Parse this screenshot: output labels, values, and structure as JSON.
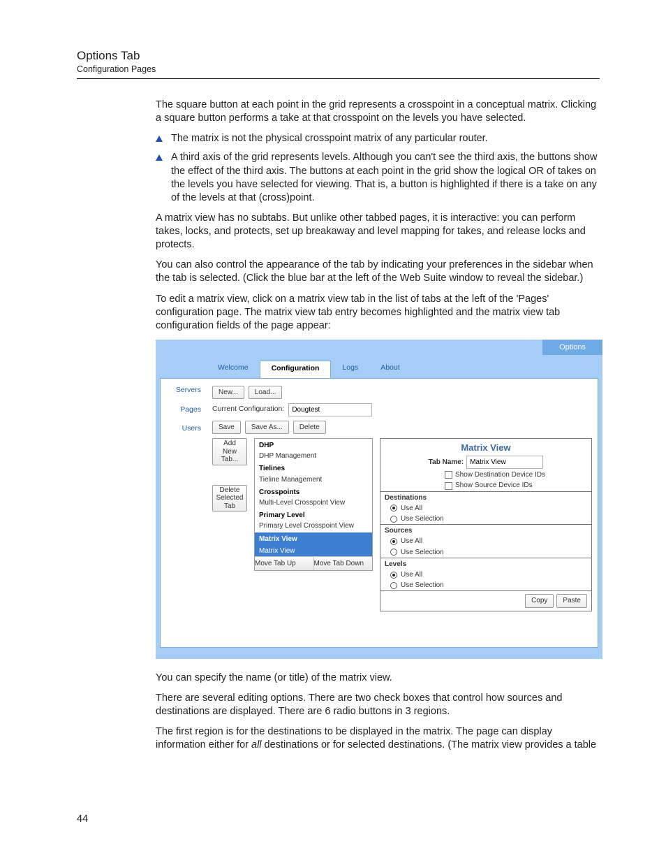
{
  "header": {
    "title": "Options Tab",
    "subtitle": "Configuration Pages"
  },
  "page_number": "44",
  "body": {
    "p1": "The square button at each point in the grid represents a crosspoint in a conceptual matrix. Clicking a square button performs a take at that crosspoint on the levels you have selected.",
    "b1": "The matrix is not the physical crosspoint matrix of any particular router.",
    "b2": "A third axis of the grid represents levels. Although you can't see the third axis, the buttons show the effect of the third axis. The buttons at each point in the grid show the logical OR of takes on the levels you have selected for viewing. That is, a button is highlighted if there is a take on any of the levels at that (cross)point.",
    "p2": "A matrix view has no subtabs. But unlike other tabbed pages, it is interactive: you can perform takes, locks, and protects, set up breakaway and level mapping for takes, and release locks and protects.",
    "p3": "You can also control the appearance of the tab by indicating your preferences in the sidebar when the tab is selected. (Click the blue bar at the left of the Web Suite window to reveal the sidebar.)",
    "p4": "To edit a matrix view, click on a matrix view tab in the list of tabs at the left of the 'Pages' configuration page. The matrix view tab entry becomes highlighted and the matrix view tab configuration fields of the page appear:",
    "p5": "You can specify the name (or title) of the matrix view.",
    "p6": "There are several editing options. There are two check boxes that control how sources and destinations are displayed. There are 6 radio buttons in 3 regions.",
    "p7a": "The first region is for the destinations to be displayed in the matrix. The page can display information either for ",
    "p7i": "all",
    "p7b": " destinations or for selected destinations. (The matrix view provides a table"
  },
  "app": {
    "top_tab": "Options",
    "nav": {
      "welcome": "Welcome",
      "configuration": "Configuration",
      "logs": "Logs",
      "about": "About"
    },
    "side": {
      "servers": "Servers",
      "pages": "Pages",
      "users": "Users"
    },
    "toolbar": {
      "new": "New...",
      "load": "Load...",
      "current_label": "Current Configuration:",
      "current_value": "Dougtest",
      "save": "Save",
      "save_as": "Save As...",
      "delete": "Delete"
    },
    "leftbtns": {
      "add": "Add\nNew\nTab...",
      "del": "Delete\nSelected\nTab"
    },
    "tree": {
      "g1": "DHP",
      "i1": "DHP Management",
      "g2": "Tielines",
      "i2": "Tieline Management",
      "g3": "Crosspoints",
      "i3": "Multi-Level Crosspoint View",
      "g4": "Primary Level",
      "i4": "Primary Level Crosspoint View",
      "g5": "Matrix View",
      "i5": "Matrix View",
      "up": "Move Tab Up",
      "down": "Move Tab Down"
    },
    "form": {
      "title": "Matrix View",
      "tabname_label": "Tab Name:",
      "tabname_value": "Matrix View",
      "chk_dest": "Show Destination Device IDs",
      "chk_src": "Show Source Device IDs",
      "sec_dest": "Destinations",
      "sec_src": "Sources",
      "sec_lvl": "Levels",
      "use_all": "Use All",
      "use_sel": "Use Selection",
      "copy": "Copy",
      "paste": "Paste"
    }
  }
}
